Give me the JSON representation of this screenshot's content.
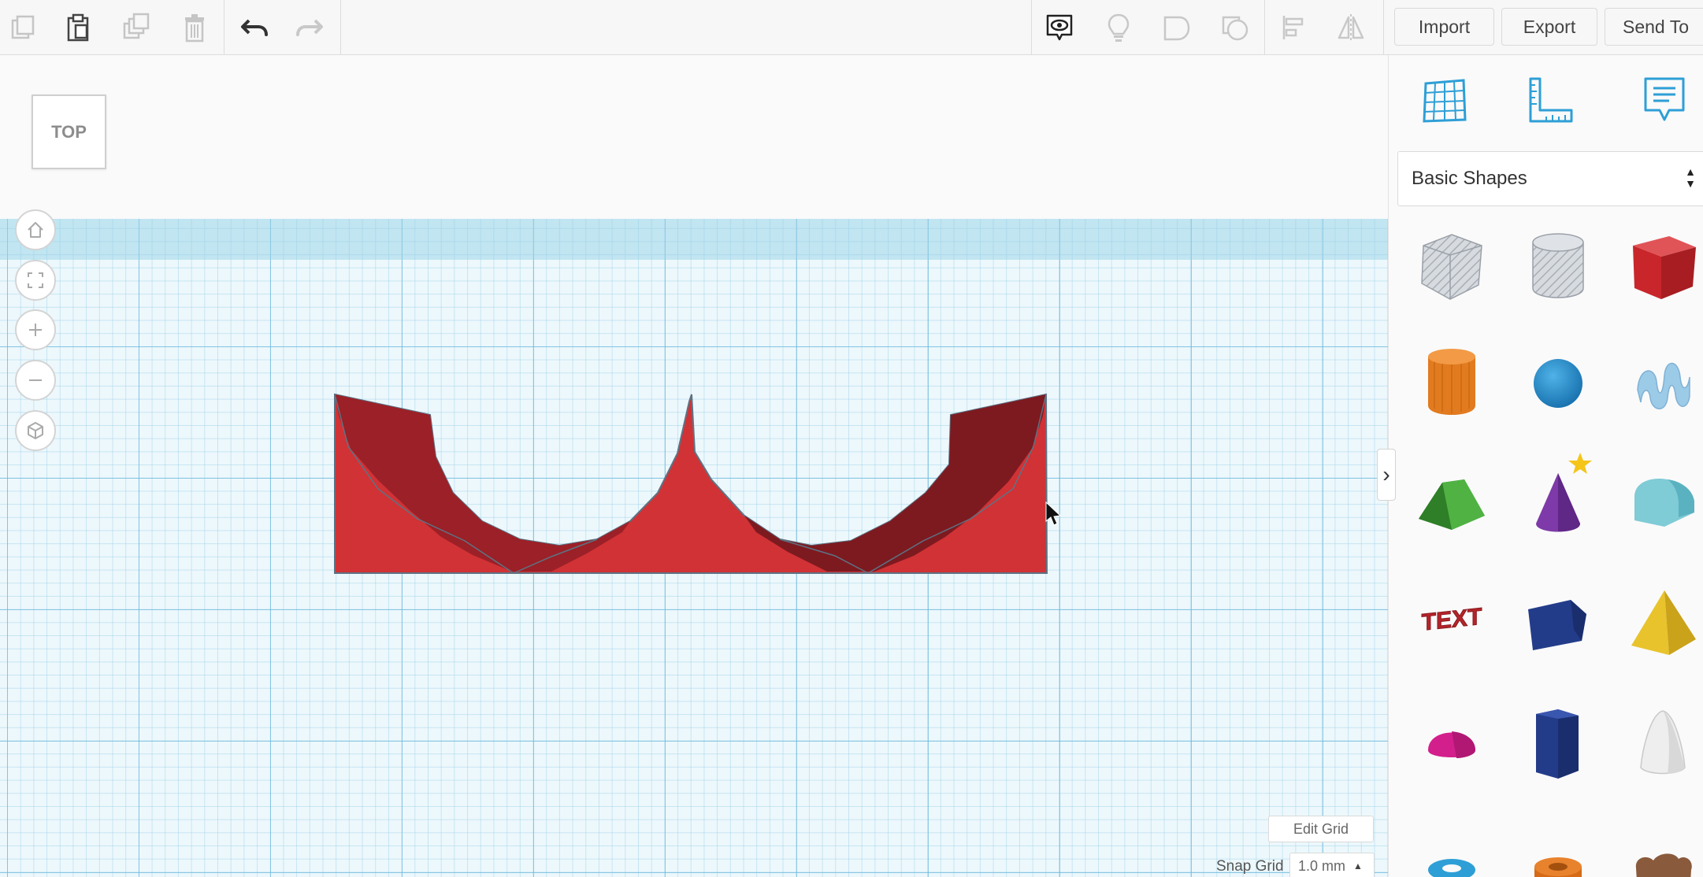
{
  "toolbar": {
    "import_label": "Import",
    "export_label": "Export",
    "send_to_label": "Send To"
  },
  "viewport": {
    "view_cube_label": "TOP",
    "edit_grid_label": "Edit Grid",
    "snap_grid_label": "Snap Grid",
    "snap_grid_value": "1.0 mm"
  },
  "panel": {
    "library_selected": "Basic Shapes",
    "shapes_text_label": "TEXT"
  },
  "colors": {
    "accent": "#2e9fd6",
    "shape_red": "#d13235",
    "shape_red_dark": "#7d1a20"
  }
}
